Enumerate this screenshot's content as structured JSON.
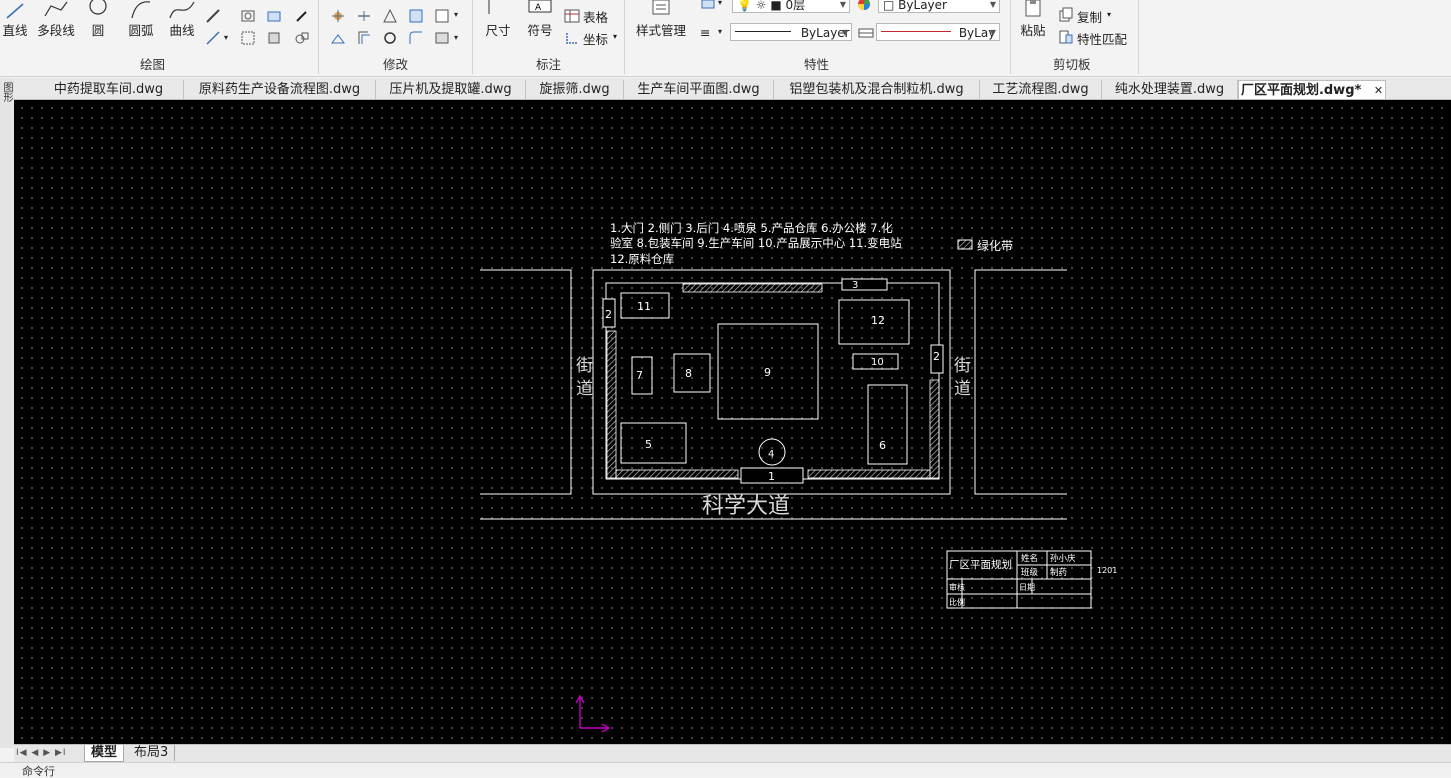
{
  "ribbon": {
    "draw": {
      "line": "直线",
      "polyline": "多段线",
      "circle": "圆",
      "arc": "圆弧",
      "curve": "曲线",
      "group_label": "绘图"
    },
    "modify": {
      "group_label": "修改"
    },
    "annotate": {
      "dimension": "尺寸",
      "symbol": "符号",
      "table": "表格",
      "coordinate": "坐标",
      "group_label": "标注"
    },
    "properties": {
      "style_manager": "样式管理",
      "layer_value": "0层",
      "color_value": "ByLayer",
      "linetype_value": "ByLayer",
      "lineweight_value": "ByLay",
      "group_label": "特性"
    },
    "clipboard": {
      "paste": "粘贴",
      "copy": "复制",
      "match_props": "特性匹配",
      "group_label": "剪切板"
    }
  },
  "doc_tabs": [
    "中药提取车间.dwg",
    "原料药生产设备流程图.dwg",
    "压片机及提取罐.dwg",
    "旋振筛.dwg",
    "生产车间平面图.dwg",
    "铝塑包装机及混合制粒机.dwg",
    "工艺流程图.dwg",
    "纯水处理装置.dwg",
    "厂区平面规划.dwg*"
  ],
  "active_tab_close": "✕",
  "left_strip_text": "图形",
  "drawing": {
    "legend_line1": "1.大门 2.侧门 3.后门 4.喷泉 5.产品仓库 6.办公楼 7.化",
    "legend_line2": "验室 8.包装车间 9.生产车间 10.产品展示中心 11.变电站",
    "legend_line3": "12.原料仓库",
    "green_belt_label": "绿化带",
    "street_left_1": "街",
    "street_left_2": "道",
    "street_right_1": "街",
    "street_right_2": "道",
    "road_name": "科学大道",
    "numbers": {
      "n1": "1",
      "n2_left": "2",
      "n2_right": "2",
      "n3": "3",
      "n4": "4",
      "n5": "5",
      "n6": "6",
      "n7": "7",
      "n8": "8",
      "n9": "9",
      "n10": "10",
      "n11": "11",
      "n12": "12"
    },
    "title_block": {
      "title": "厂区平面规划",
      "r1c3": "姓名",
      "r1c4": "孙小庆",
      "r2c3": "班级",
      "r2c4": "制药",
      "r3c1": "审核",
      "r3c3": "日期",
      "r4c1": "比例",
      "side_note": "1201"
    }
  },
  "layout_tabs": {
    "nav": "I◀ ◀ ▶ ▶I",
    "model": "模型",
    "layout3": "布局3"
  },
  "command_line": "命令行"
}
